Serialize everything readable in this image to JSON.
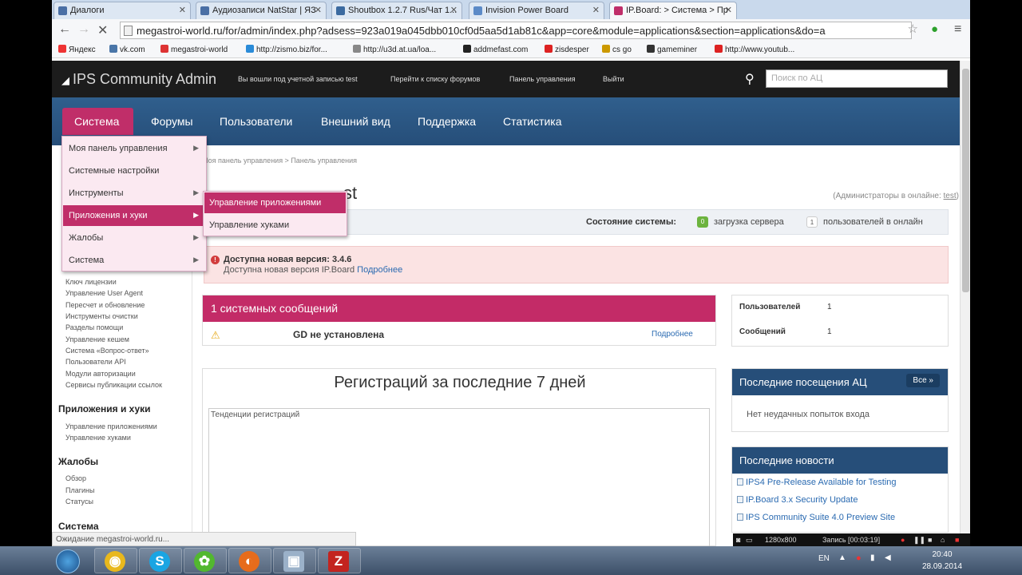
{
  "browser": {
    "tabs": [
      {
        "label": "Диалоги",
        "color": "#4a6fa5"
      },
      {
        "label": "Аудиозаписи NatStar | ЯЗ",
        "color": "#4a6fa5"
      },
      {
        "label": "Shoutbox 1.2.7 Rus/Чат 1...",
        "color": "#3b6aa0"
      },
      {
        "label": "Invision Power Board",
        "color": "#5b8ac7"
      },
      {
        "label": "IP.Board: > Система > Пр",
        "color": "#c02e69"
      }
    ],
    "url": "megastroi-world.ru/for/admin/index.php?adsess=923a019a045dbb010cf0d5aa5d1ab81c&app=core&module=applications&section=applications&do=a",
    "bookmarks": [
      {
        "label": "Яндекс",
        "color": "#e33"
      },
      {
        "label": "vk.com",
        "color": "#4a76a8"
      },
      {
        "label": "megastroi-world",
        "color": "#d33"
      },
      {
        "label": "http://zismo.biz/for...",
        "color": "#2a8bd8"
      },
      {
        "label": "http://u3d.at.ua/loa...",
        "color": "#888"
      },
      {
        "label": "addmefast.com",
        "color": "#222"
      },
      {
        "label": "zisdesper",
        "color": "#d22"
      },
      {
        "label": "cs go",
        "color": "#c90"
      },
      {
        "label": "gameminer",
        "color": "#333"
      },
      {
        "label": "http://www.youtub...",
        "color": "#d22"
      }
    ]
  },
  "header": {
    "brand": "IPS Community Admin",
    "links": [
      "Вы вошли под учетной записью test",
      "Перейти к списку форумов",
      "Панель управления",
      "Выйти"
    ],
    "search_placeholder": "Поиск по АЦ"
  },
  "nav": {
    "active": "Система",
    "items": [
      "Форумы",
      "Пользователи",
      "Внешний вид",
      "Поддержка",
      "Статистика"
    ]
  },
  "menu": {
    "items": [
      {
        "label": "Моя панель управления",
        "arrow": true
      },
      {
        "label": "Системные настройки",
        "arrow": false
      },
      {
        "label": "Инструменты",
        "arrow": true
      },
      {
        "label": "Приложения и хуки",
        "arrow": true
      },
      {
        "label": "Жалобы",
        "arrow": true
      },
      {
        "label": "Система",
        "arrow": true
      }
    ],
    "submenu": [
      "Управление приложениями",
      "Управление хуками"
    ]
  },
  "sidebar": {
    "group1_items": [
      "Ключ лицензии",
      "Управление User Agent",
      "Пересчет и обновление",
      "Инструменты очистки",
      "Разделы помощи",
      "Управление кешем",
      "Система «Вопрос-ответ»",
      "Пользователи API",
      "Модули авторизации",
      "Сервисы публикации ссылок"
    ],
    "group2_title": "Приложения и хуки",
    "group2_items": [
      "Управление приложениями",
      "Управление хуками"
    ],
    "group3_title": "Жалобы",
    "group3_items": [
      "Обзор",
      "Плагины",
      "Статусы"
    ],
    "group4_title": "Система"
  },
  "content": {
    "breadcrumb": "Моя панель управления  >  Панель управления",
    "title_fragment": "st",
    "admins_online_label": "(Администраторы в онлайне:",
    "admins_online_user": "test",
    "admins_online_close": ")",
    "status_label": "Состояние системы:",
    "server_load_value": "0",
    "server_load_label": "загрузка сервера",
    "users_online_value": "1",
    "users_online_label": "пользователей в онлайн",
    "update_title": "Доступна новая версия: 3.4.6",
    "update_text": "Доступна новая версия IP.Board",
    "update_link": "Подробнее",
    "sysmsg_title": "1 системных сообщений",
    "gd_text": "GD не установлена",
    "gd_link": "Подробнее",
    "stats": [
      {
        "label": "Пользователей",
        "value": "1"
      },
      {
        "label": "Сообщений",
        "value": "1"
      }
    ],
    "reg_title": "Регистраций за последние 7 дней",
    "trend_title": "Тенденции регистраций",
    "recent_visits_title": "Последние посещения АЦ",
    "all_button": "Все »",
    "no_failed": "Нет неудачных попыток входа",
    "news_title": "Последние новости",
    "news": [
      "IPS4 Pre-Release Available for Testing",
      "IP.Board 3.x Security Update",
      "IPS Community Suite 4.0 Preview Site"
    ]
  },
  "status_bubble": "Ожидание megastroi-world.ru...",
  "recorder": {
    "resolution": "1280x800",
    "record_label": "Запись [00:03:19]"
  },
  "taskbar": {
    "lang": "EN",
    "time": "20:40",
    "date": "28.09.2014"
  }
}
